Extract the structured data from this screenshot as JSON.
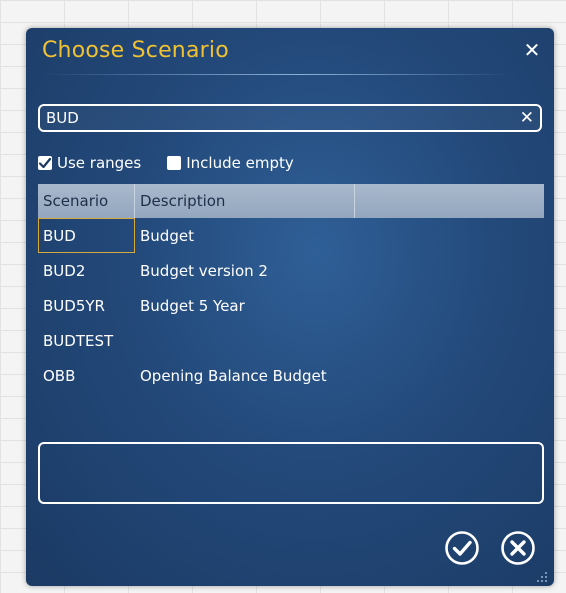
{
  "dialog": {
    "title": "Choose Scenario",
    "close_icon": "close-icon"
  },
  "search": {
    "value": "BUD",
    "clear_icon": "clear-icon"
  },
  "options": {
    "use_ranges": {
      "label": "Use ranges",
      "checked": true
    },
    "include_empty": {
      "label": "Include empty",
      "checked": false
    }
  },
  "grid": {
    "columns": [
      "Scenario",
      "Description"
    ],
    "rows": [
      {
        "scenario": "BUD",
        "description": "Budget",
        "selected": true
      },
      {
        "scenario": "BUD2",
        "description": "Budget version 2",
        "selected": false
      },
      {
        "scenario": "BUD5YR",
        "description": "Budget 5 Year",
        "selected": false
      },
      {
        "scenario": "BUDTEST",
        "description": "",
        "selected": false
      },
      {
        "scenario": "OBB",
        "description": "Opening Balance Budget",
        "selected": false
      }
    ]
  },
  "notes": {
    "value": ""
  },
  "actions": {
    "ok_icon": "checkmark-circle-icon",
    "cancel_icon": "cancel-circle-icon"
  },
  "colors": {
    "title": "#f0c233",
    "dialog_bg": "#23497a",
    "header_bg": "#a9b9cd",
    "selection_border": "#d6a93a"
  }
}
